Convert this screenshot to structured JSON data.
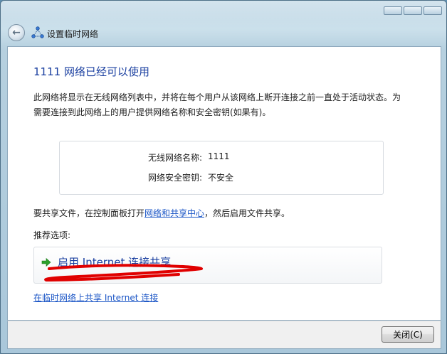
{
  "window": {
    "title": "设置临时网络",
    "back_glyph": "←"
  },
  "main": {
    "heading": "1111 网络已经可以使用",
    "description": "此网络将显示在无线网络列表中，并将在每个用户从该网络上断开连接之前一直处于活动状态。为需要连接到此网络上的用户提供网络名称和安全密钥(如果有)。",
    "info": {
      "name_label": "无线网络名称:",
      "name_value": "1111",
      "key_label": "网络安全密钥:",
      "key_value": "不安全"
    },
    "share_text_prefix": "要共享文件，在控制面板打开",
    "share_text_link": "网络和共享中心",
    "share_text_suffix": "，然后启用文件共享。",
    "recommend_label": "推荐选项:",
    "option_label": "启用 Internet 连接共享",
    "share_link": "在临时网络上共享 Internet 连接"
  },
  "footer": {
    "close_label": "关闭(C)"
  },
  "colors": {
    "heading": "#1a3fa0",
    "link": "#1a55c6",
    "arrow": "#2ca02c",
    "scribble": "#e00000"
  },
  "icons": {
    "back": "back-arrow-icon",
    "title": "network-icon",
    "option": "green-arrow-icon"
  }
}
